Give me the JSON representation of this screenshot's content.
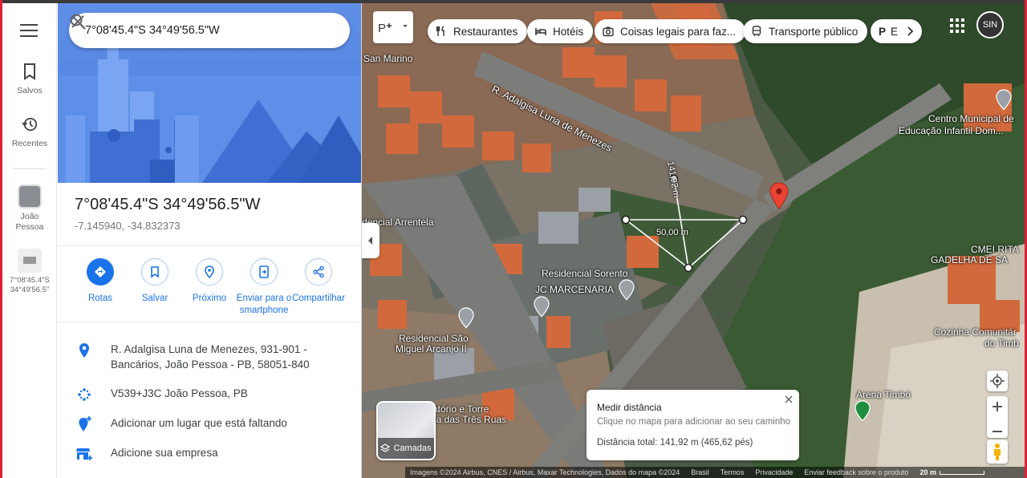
{
  "rail": {
    "saved_label": "Salvos",
    "recent_label": "Recentes",
    "recent_place_1": "João Pessoa",
    "recent_place_2_line1": "7°08'45.4\"S",
    "recent_place_2_line2": "34°49'56.5\""
  },
  "search": {
    "value": "7°08'45.4\"S 34°49'56.5\"W"
  },
  "place": {
    "title": "7°08'45.4\"S 34°49'56.5\"W",
    "decimal": "-7.145940, -34.832373"
  },
  "actions": {
    "directions": "Rotas",
    "save": "Salvar",
    "nearby": "Próximo",
    "send_line1": "Enviar para o",
    "send_line2": "smartphone",
    "share": "Compartilhar"
  },
  "info": {
    "address_line1": "R. Adalgisa Luna de Menezes, 931-901 -",
    "address_line2": "Bancários, João Pessoa - PB, 58051-840",
    "plus_code": "V539+J3C João Pessoa, PB",
    "add_place": "Adicionar um lugar que está faltando",
    "add_business": "Adicione sua empresa"
  },
  "chips": {
    "restaurants": "Restaurantes",
    "hotels": "Hotéis",
    "things": "Coisas legais para faz...",
    "transit": "Transporte público",
    "parking": "E"
  },
  "user": {
    "initials": "SIN"
  },
  "map_labels": {
    "san_marino": "San Marino",
    "street": "R. Adalgisa Luna de Menezes",
    "centro_line1": "Centro Municipal de",
    "centro_line2": "Educação Infantil Dom...",
    "arrentela": "dencial Arrentela",
    "sorento": "Residencial Sorento",
    "marcenaria": "JC MARCENARIA",
    "cmei_line1": "CMEI RITA",
    "cmei_line2": "GADELHA DE SA",
    "sao_miguel_line1": "Residencial São",
    "sao_miguel_line2": "Miguel Arcanjo II",
    "torre_line1": "atório e Torre",
    "torre_line2": "ica das Três Ruas",
    "cozinha_line1": "Cozinha Comunitár",
    "cozinha_line2": "do Timb",
    "arena": "Arena Timbó",
    "dist_vertical": "141,92 m",
    "dist_horizontal": "50,00 m"
  },
  "layers_label": "Camadas",
  "measure": {
    "title": "Medir distância",
    "hint": "Clique no mapa para adicionar ao seu caminho",
    "total": "Distância total: 141,92 m (465,62 pés)"
  },
  "footer": {
    "attribution": "Imagens ©2024 Airbus, CNES / Airbus, Maxar Technologies, Dados do mapa ©2024",
    "country": "Brasil",
    "terms": "Termos",
    "privacy": "Privacidade",
    "feedback": "Enviar feedback sobre o produto",
    "scale": "20 m"
  }
}
